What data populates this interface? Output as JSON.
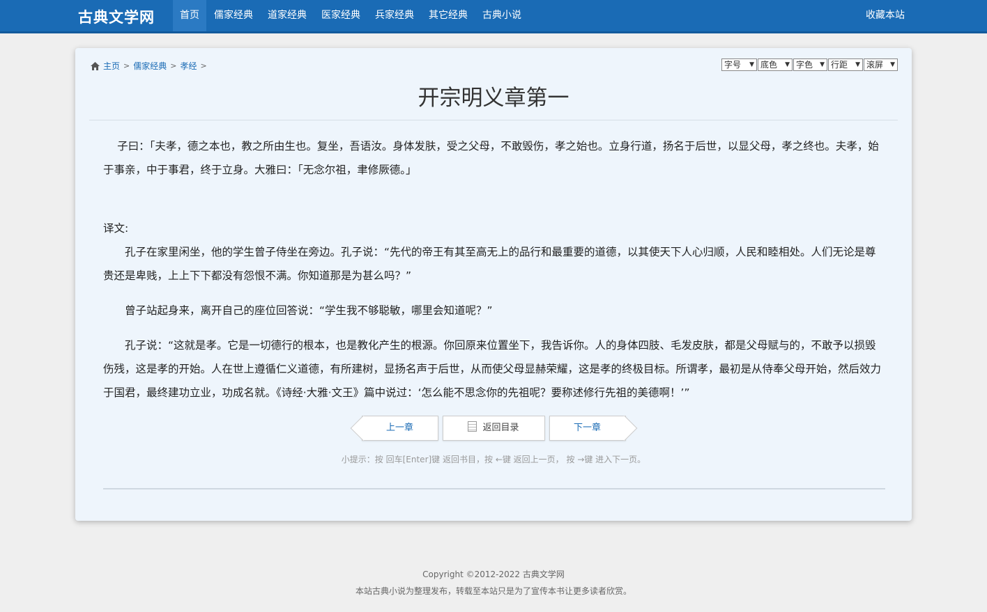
{
  "header": {
    "logo": "古典文学网",
    "nav": [
      "首页",
      "儒家经典",
      "道家经典",
      "医家经典",
      "兵家经典",
      "其它经典",
      "古典小说"
    ],
    "favorite": "收藏本站"
  },
  "breadcrumb": [
    "主页",
    "儒家经典",
    "孝经"
  ],
  "tools": [
    "字号",
    "底色",
    "字色",
    "行距",
    "滚屏"
  ],
  "title": "开宗明义章第一",
  "content": {
    "original": "子曰：「夫孝，德之本也，教之所由生也。复坐，吾语汝。身体发肤，受之父母，不敢毁伤，孝之始也。立身行道，扬名于后世，以显父母，孝之终也。夫孝，始于事亲，中于事君，终于立身。大雅曰：「无念尔祖，聿修厥德。」",
    "translation_label": "译文:",
    "translation": [
      "孔子在家里闲坐，他的学生曾子侍坐在旁边。孔子说：“先代的帝王有其至高无上的品行和最重要的道德，以其使天下人心归顺，人民和睦相处。人们无论是尊贵还是卑贱，上上下下都没有怨恨不满。你知道那是为甚么吗？”",
      "曾子站起身来，离开自己的座位回答说：“学生我不够聪敏，哪里会知道呢？”",
      "孔子说：“这就是孝。它是一切德行的根本，也是教化产生的根源。你回原来位置坐下，我告诉你。人的身体四肢、毛发皮肤，都是父母赋与的，不敢予以损毁伤残，这是孝的开始。人在世上遵循仁义道德，有所建树，显扬名声于后世，从而使父母显赫荣耀，这是孝的终极目标。所谓孝，最初是从侍奉父母开始，然后效力于国君，最终建功立业，功成名就。《诗经·大雅·文王》篇中说过：‘怎么能不思念你的先祖呢？要称述修行先祖的美德啊！’”"
    ]
  },
  "pager": {
    "prev": "上一章",
    "toc": "返回目录",
    "next": "下一章"
  },
  "hint": "小提示：按 回车[Enter]键 返回书目，按 ←键 返回上一页， 按 →键 进入下一页。",
  "footer": {
    "copyright": "Copyright ©2012-2022 古典文学网",
    "notice": "本站古典小说为整理发布，转载至本站只是为了宣传本书让更多读者欣赏。"
  },
  "colors": {
    "nav_bg": "#1a6bb5",
    "panel_bg": "#eef5fc",
    "link": "#1a6bb5"
  },
  "icons": [
    "home-icon",
    "document-icon"
  ]
}
